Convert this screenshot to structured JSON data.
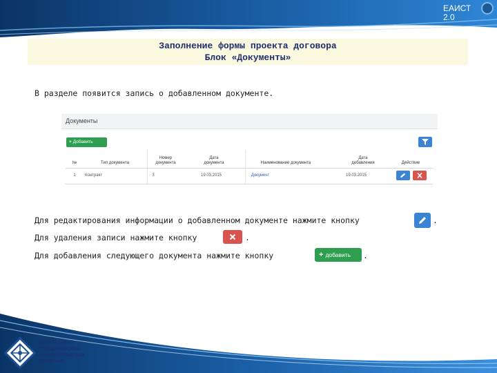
{
  "brand": {
    "line1": "ЕАИСТ",
    "line2": "2.0"
  },
  "title": {
    "line1": "Заполнение формы проекта договора",
    "line2": "Блок «Документы»"
  },
  "intro_text": "В разделе появится запись о добавленном документе.",
  "panel": {
    "heading": "Документы",
    "add_button_label": "Добавить",
    "columns": [
      "№",
      "Тип документа",
      "Номер документа",
      "Дата документа",
      "Наименование документа",
      "Дата добавления",
      "Действие"
    ],
    "rows": [
      [
        "1",
        "Контракт",
        "3",
        "19.03.2015",
        "Документ",
        "19.03.2015"
      ]
    ]
  },
  "instructions": {
    "edit": "Для редактирования информации о добавленном документе нажмите кнопку",
    "delete": "Для удаления записи нажмите кнопку",
    "add": "Для добавления следующего документа нажмите кнопку",
    "add_button_label": "добавить",
    "period": "."
  },
  "footer": {
    "dept_lines": [
      "ДЕПАРТАМЕНТ",
      "ГОРОДА МОСКВЫ",
      "ПО КОНКУРЕНТНОЙ",
      "ПОЛИТИКЕ"
    ]
  },
  "icons": {
    "edit": "pencil-icon",
    "delete": "close-icon",
    "filter": "filter-icon",
    "add": "plus-icon",
    "logo": "department-logo-icon"
  },
  "colors": {
    "header_dark": "#0d3b73",
    "header_light": "#3a8ed8",
    "title_bg": "#fbf8e0",
    "title_text": "#1d2f6e",
    "add_green": "#2e9e50",
    "edit_blue": "#3b84d4",
    "delete_red": "#d9534f"
  }
}
